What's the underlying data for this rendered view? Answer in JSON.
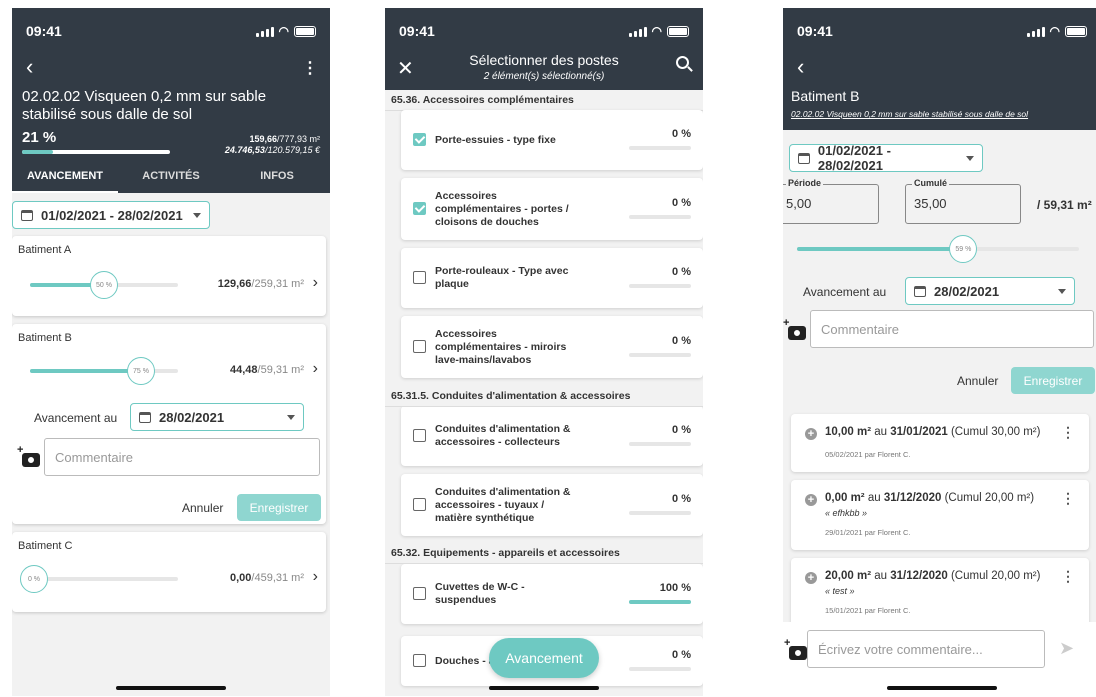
{
  "screen1": {
    "status_time": "09:41",
    "title": "02.02.02 Visqueen 0,2 mm sur sable stabilisé sous dalle de sol",
    "percent": "21 %",
    "qty_done": "159,66",
    "qty_total": "/777,93 m²",
    "amount_done": "24.746,53",
    "amount_total": "/120.579,15 €",
    "progress": 0.21,
    "tabs": [
      "AVANCEMENT",
      "ACTIVITÉS",
      "INFOS"
    ],
    "date_range": "01/02/2021 - 28/02/2021",
    "buildings": [
      {
        "name": "Batiment A",
        "knob": "50 %",
        "fill": 0.5,
        "done": "129,66",
        "total": "/259,31 m²"
      },
      {
        "name": "Batiment B",
        "knob": "75 %",
        "fill": 0.75,
        "done": "44,48",
        "total": "/59,31 m²"
      },
      {
        "name": "Batiment C",
        "knob": "0 %",
        "fill": 0,
        "done": "0,00",
        "total": "/459,31 m²"
      }
    ],
    "avancement_label": "Avancement au",
    "avancement_date": "28/02/2021",
    "comment_placeholder": "Commentaire",
    "cancel": "Annuler",
    "save": "Enregistrer"
  },
  "screen2": {
    "status_time": "09:41",
    "title": "Sélectionner des postes",
    "subtitle": "2 élément(s) sélectionné(s)",
    "sections": [
      "65.36. Accessoires complémentaires",
      "65.31.5. Conduites d'alimentation & accessoires",
      "65.32. Equipements - appareils et accessoires"
    ],
    "items": [
      {
        "l1": "Porte-essuies - type fixe",
        "l2": "",
        "l3": "",
        "pct": "0 %",
        "fill": 0,
        "checked": true
      },
      {
        "l1": "Accessoires",
        "l2": "complémentaires - portes /",
        "l3": "cloisons de douches",
        "pct": "0 %",
        "fill": 0,
        "checked": true
      },
      {
        "l1": "Porte-rouleaux - Type avec",
        "l2": "plaque",
        "l3": "",
        "pct": "0 %",
        "fill": 0,
        "checked": false
      },
      {
        "l1": "Accessoires",
        "l2": "complémentaires - miroirs",
        "l3": "lave-mains/lavabos",
        "pct": "0 %",
        "fill": 0,
        "checked": false
      },
      {
        "l1": "Conduites d'alimentation &",
        "l2": "accessoires - collecteurs",
        "l3": "",
        "pct": "0 %",
        "fill": 0,
        "checked": false
      },
      {
        "l1": "Conduites d'alimentation &",
        "l2": "accessoires - tuyaux /",
        "l3": "matière synthétique",
        "pct": "0 %",
        "fill": 0,
        "checked": false
      },
      {
        "l1": "Cuvettes de W-C -",
        "l2": "suspendues",
        "l3": "",
        "pct": "100 %",
        "fill": 1,
        "checked": false
      },
      {
        "l1": "Douches - ac",
        "l2": "",
        "l3": "",
        "pct": "0 %",
        "fill": 0,
        "checked": false
      }
    ],
    "fab": "Avancement"
  },
  "screen3": {
    "status_time": "09:41",
    "title": "Batiment B",
    "subtitle": "02.02.02 Visqueen 0,2 mm sur sable stabilisé sous dalle de sol",
    "date_range": "01/02/2021 - 28/02/2021",
    "periode_label": "Période",
    "periode_value": "5,00",
    "cumule_label": "Cumulé",
    "cumule_value": "35,00",
    "total": "/ 59,31 m²",
    "knob": "59 %",
    "fill": 0.59,
    "avancement_label": "Avancement au",
    "avancement_date": "28/02/2021",
    "comment_placeholder": "Commentaire",
    "cancel": "Annuler",
    "save": "Enregistrer",
    "history": [
      {
        "qty": "10,00 m²",
        "au": " au ",
        "date": "31/01/2021",
        "cumul": " (Cumul 30,00 m²)",
        "note": "",
        "meta": "05/02/2021 par Florent C."
      },
      {
        "qty": "0,00 m²",
        "au": " au ",
        "date": "31/12/2020",
        "cumul": " (Cumul 20,00 m²)",
        "note": "« efhkbb »",
        "meta": "29/01/2021 par Florent C."
      },
      {
        "qty": "20,00 m²",
        "au": " au ",
        "date": "31/12/2020",
        "cumul": " (Cumul 20,00 m²)",
        "note": "« test »",
        "meta": "15/01/2021 par Florent C."
      }
    ],
    "write_placeholder": "Écrivez votre commentaire..."
  }
}
